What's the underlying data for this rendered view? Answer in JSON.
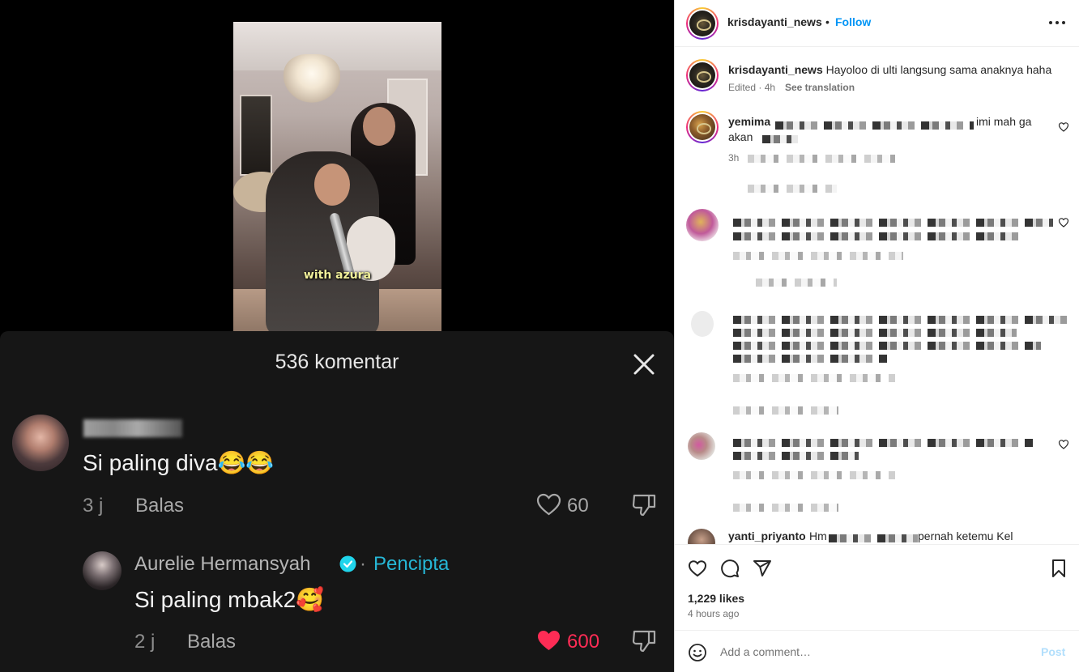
{
  "video": {
    "caption": "with azura"
  },
  "tiktok": {
    "comment_count_label": "536 komentar",
    "comments": [
      {
        "text": "Si paling diva😂😂",
        "time": "3 j",
        "reply_label": "Balas",
        "likes": "60",
        "liked": false
      },
      {
        "author": "Aurelie Hermansyah",
        "separator": "·",
        "badge": "Pencipta",
        "text": "Si paling mbak2🥰",
        "time": "2 j",
        "reply_label": "Balas",
        "likes": "600",
        "liked": true
      }
    ]
  },
  "instagram": {
    "header": {
      "username": "krisdayanti_news",
      "bullet": "•",
      "follow_label": "Follow"
    },
    "caption": {
      "username": "krisdayanti_news",
      "text": "Hayoloo di ulti langsung sama anaknya haha",
      "edited": "Edited · 4h",
      "see_translation": "See translation"
    },
    "comments": [
      {
        "username": "yemima",
        "visible_text_a": "imi mah ga",
        "visible_text_b": "akan ",
        "meta": "3h"
      },
      {
        "username": "yanti_priyanto",
        "visible_text_a": "Hm",
        "visible_text_b": "pernah ketemu Kel"
      }
    ],
    "likes": "1,229 likes",
    "time": "4 hours ago",
    "add_comment_placeholder": "Add a comment…",
    "post_label": "Post"
  },
  "colors": {
    "ig_blue": "#0095f6",
    "ig_post_disabled": "#b2dffc",
    "tiktok_creator": "#26b7d6",
    "tiktok_heart": "#fe2c55"
  },
  "icons": [
    "close-icon",
    "heart-icon",
    "dislike-icon",
    "verified-icon",
    "more-icon",
    "comment-icon",
    "share-icon",
    "bookmark-icon",
    "emoji-icon"
  ]
}
